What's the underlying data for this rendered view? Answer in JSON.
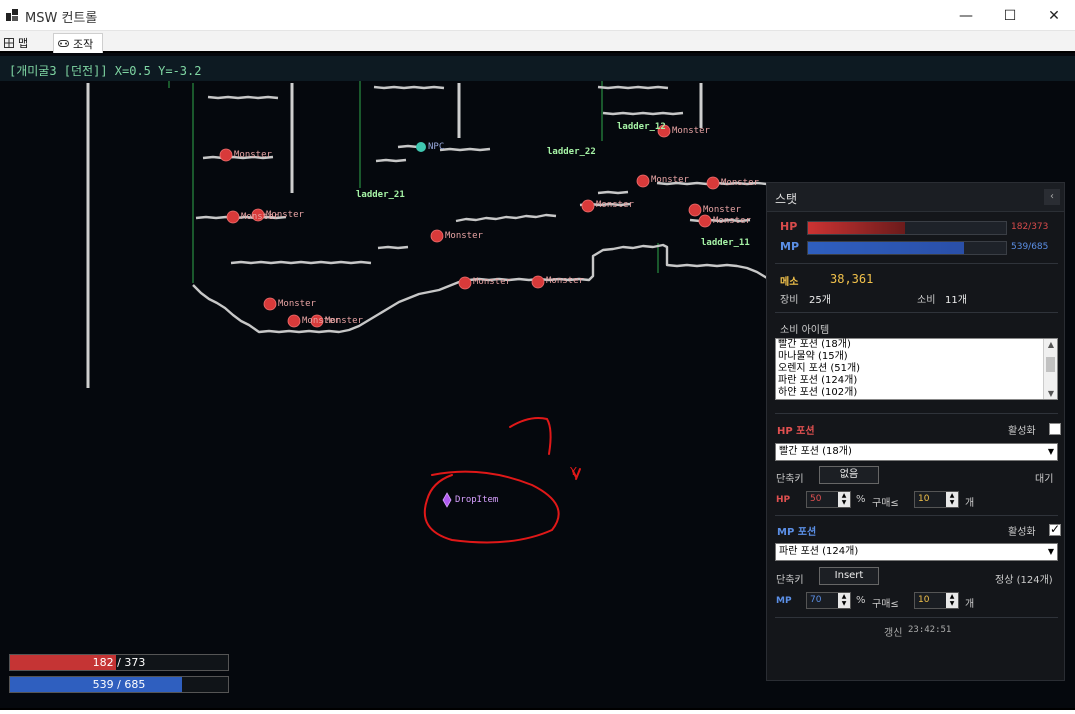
{
  "window": {
    "title": "MSW 컨트롤",
    "min": "—",
    "max": "☐",
    "close": "✕"
  },
  "tabs": [
    {
      "label": "맵",
      "icon": "map-icon"
    },
    {
      "label": "조작",
      "icon": "gamepad-icon"
    }
  ],
  "status": {
    "text": "[개미굴3 [던전]]  X=0.5 Y=-3.2"
  },
  "map": {
    "monsters": [
      "Monster",
      "Monster",
      "Monster",
      "Monster",
      "Monster",
      "Monster",
      "Monster",
      "Monster",
      "Monster",
      "Monster",
      "Monster",
      "Monster",
      "Monster",
      "Monster",
      "Monster",
      "Monster",
      "Monster",
      "Monster",
      "Monster",
      "Monster"
    ],
    "ladders": [
      "ladder_12",
      "ladder_22",
      "ladder_21",
      "ladder_11"
    ],
    "npc": "NPC",
    "drop_item": "DropItem",
    "annotation_mark": "Y"
  },
  "bars": {
    "hp": {
      "text": "182 / 373",
      "fraction": 0.488,
      "color": "#c53434"
    },
    "mp": {
      "text": "539 / 685",
      "fraction": 0.787,
      "color": "#2f5fbf"
    }
  },
  "panel": {
    "title": "스탯",
    "close": "‹",
    "hp": {
      "label": "HP",
      "value": "182/373",
      "fraction": 0.488
    },
    "mp": {
      "label": "MP",
      "value": "539/685",
      "fraction": 0.787
    },
    "meso": {
      "label": "메소",
      "value": "38,361"
    },
    "equip": {
      "label": "장비",
      "value": "25개"
    },
    "consume": {
      "label": "소비",
      "value": "11개"
    },
    "consume_items_label": "소비 아이템",
    "consume_items": [
      "빨간 포션 (18개)",
      "마나물약 (15개)",
      "오렌지 포션 (51개)",
      "파란 포션 (124개)",
      "하얀 포션 (102개)"
    ],
    "hp_potion": {
      "title": "HP 포션",
      "activate_label": "활성화",
      "activated": false,
      "selected": "빨간 포션 (18개)",
      "hotkey_label": "단축키",
      "hotkey": "없음",
      "state": "대기",
      "threshold_label": "HP",
      "threshold": "50",
      "percent": "%",
      "buy_label": "구매≤",
      "buy": "10",
      "unit": "개"
    },
    "mp_potion": {
      "title": "MP 포션",
      "activate_label": "활성화",
      "activated": true,
      "selected": "파란 포션 (124개)",
      "hotkey_label": "단축키",
      "hotkey": "Insert",
      "state": "정상 (124개)",
      "threshold_label": "MP",
      "threshold": "70",
      "percent": "%",
      "buy_label": "구매≤",
      "buy": "10",
      "unit": "개"
    },
    "updated_label": "갱신",
    "updated_time": "23:42:51"
  },
  "colors": {
    "hp_accent": "#d84b4b",
    "mp_accent": "#5b8fe6",
    "meso": "#f1c14b",
    "monster": "#d83a3a"
  }
}
